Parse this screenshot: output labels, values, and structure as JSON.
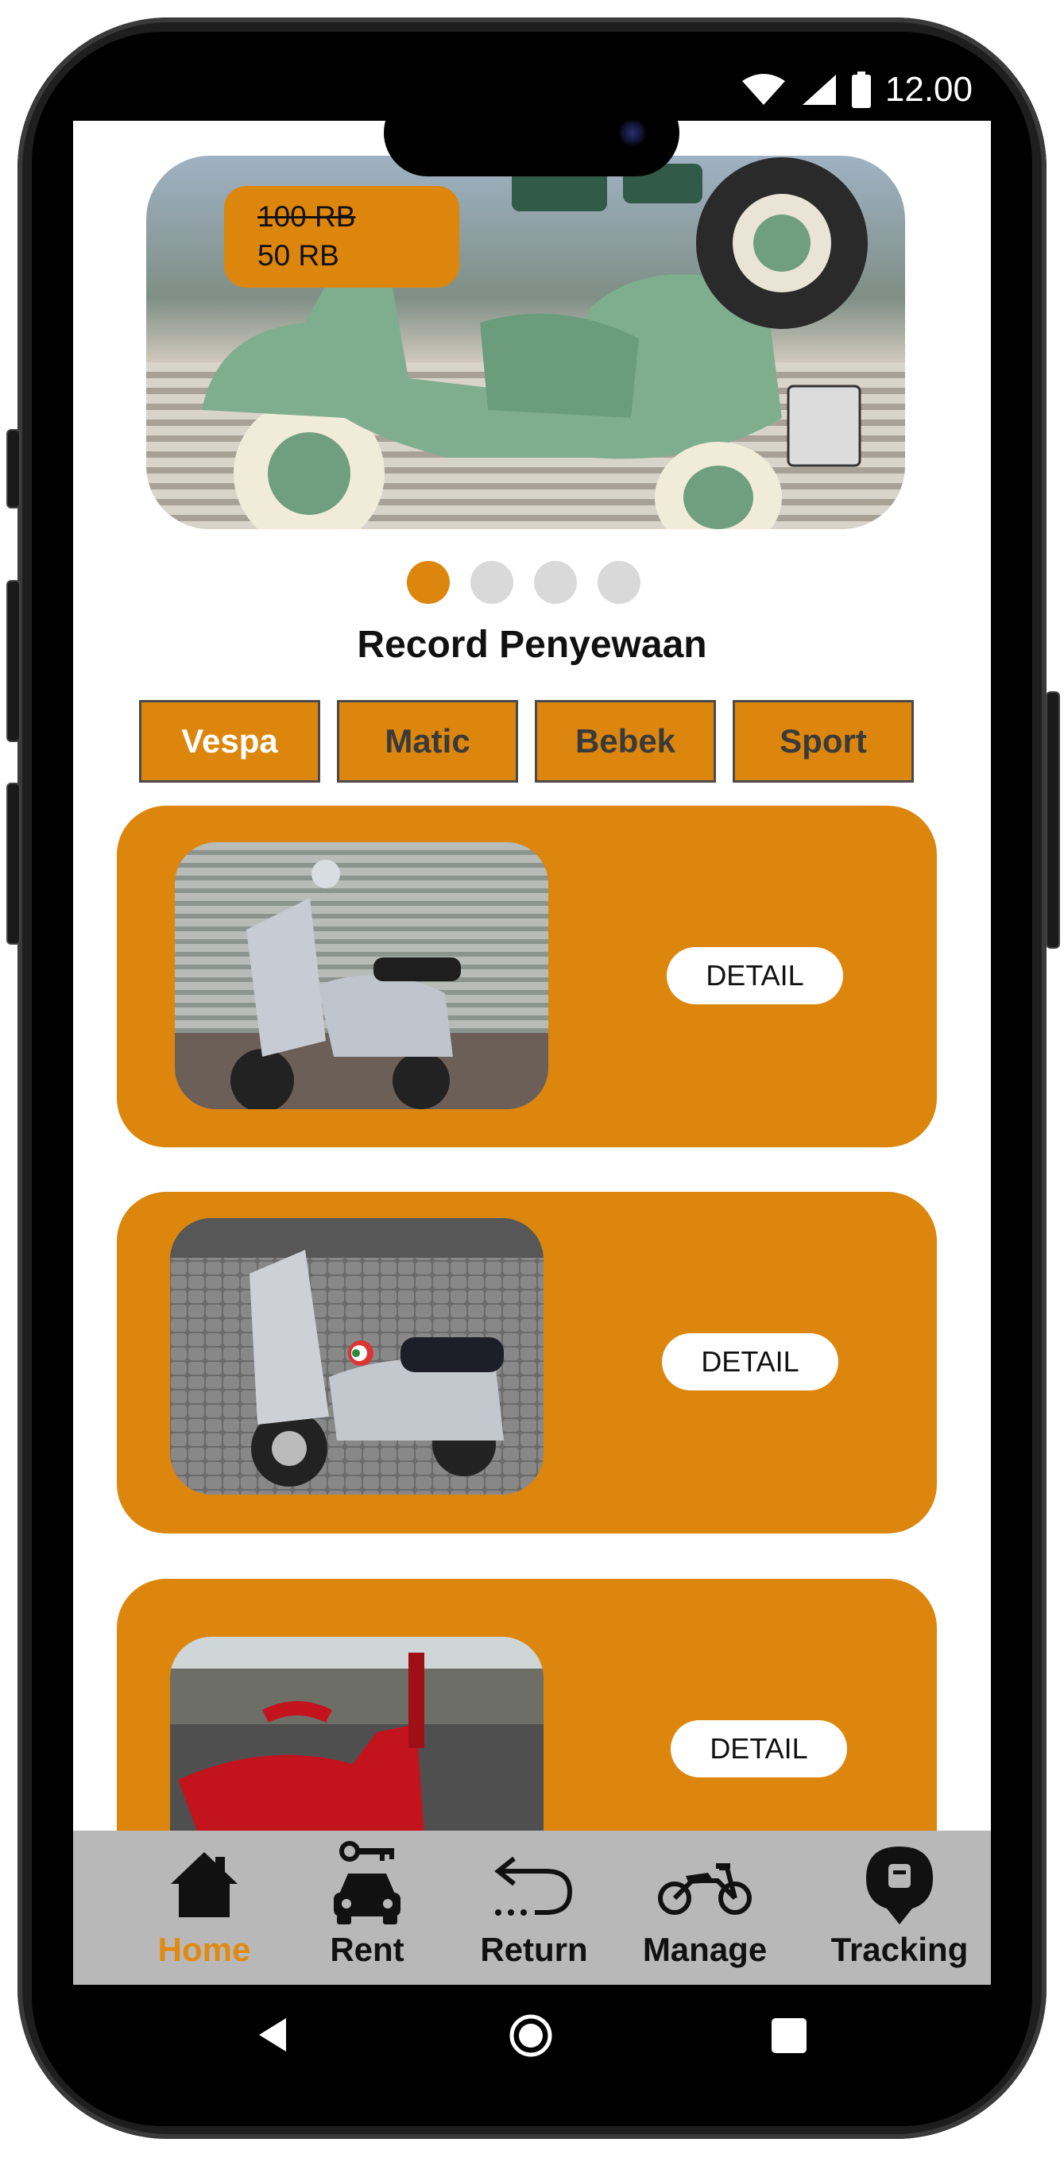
{
  "status_bar": {
    "time": "12.00"
  },
  "banner": {
    "price_old": "100 RB",
    "price_new": "50 RB",
    "page_count": 4,
    "active_index": 0
  },
  "section_title": "Record Penyewaan",
  "tabs": [
    {
      "label": "Vespa",
      "active": true
    },
    {
      "label": "Matic",
      "active": false
    },
    {
      "label": "Bebek",
      "active": false
    },
    {
      "label": "Sport",
      "active": false
    }
  ],
  "cards": [
    {
      "image": "silver-vespa-photo",
      "button_label": "DETAIL"
    },
    {
      "image": "silver-vespa-cobblestone-photo",
      "button_label": "DETAIL"
    },
    {
      "image": "red-vespa-photo",
      "button_label": "DETAIL"
    }
  ],
  "bottom_nav": [
    {
      "label": "Home",
      "icon": "home-icon",
      "active": true
    },
    {
      "label": "Rent",
      "icon": "car-key-icon",
      "active": false
    },
    {
      "label": "Return",
      "icon": "return-arrow-icon",
      "active": false
    },
    {
      "label": "Manage",
      "icon": "motorcycle-icon",
      "active": false
    },
    {
      "label": "Tracking",
      "icon": "location-pin-icon",
      "active": false
    }
  ],
  "colors": {
    "accent": "#dc860d",
    "nav_bg": "#b8b8b8",
    "active_nav": "#e08a12"
  }
}
